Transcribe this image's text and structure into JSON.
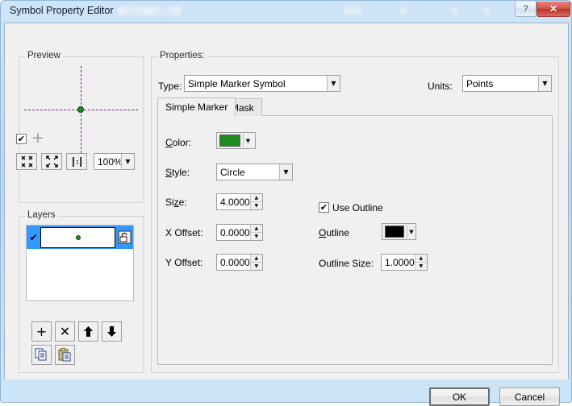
{
  "window": {
    "title": "Symbol Property Editor",
    "help_button": "?",
    "close_button": "✕"
  },
  "preview": {
    "legend": "Preview",
    "visible_checked": true,
    "check_glyph": "✔",
    "add_icon": "+",
    "zoom_in_name": "zoom-in",
    "zoom_out_name": "zoom-out",
    "zoom_ratio_name": "1:1",
    "zoom_value": "100%",
    "dropdown_arrow": "▼",
    "marker_color": "#1f8a1f",
    "crosshair_color": "#7b2f7b"
  },
  "layers": {
    "legend": "Layers",
    "rows": [
      {
        "checked": true,
        "check_glyph": "✔",
        "lock_icon": "unlock-icon",
        "selected": true
      }
    ],
    "buttons": {
      "add": "+",
      "delete": "✕",
      "move_up": "↑",
      "move_down": "↓",
      "copy": "copy-icon",
      "paste": "paste-icon"
    }
  },
  "properties": {
    "legend": "Properties:",
    "type_label": "Type:",
    "type_value": "Simple Marker Symbol",
    "units_label": "Units:",
    "units_value": "Points",
    "dropdown_arrow": "▼",
    "tabs": [
      {
        "label": "Simple Marker",
        "active": true
      },
      {
        "label": "Mask",
        "active": false
      }
    ]
  },
  "simple_marker": {
    "color_label": "Color:",
    "color_value": "#1f8a1f",
    "style_label": "Style:",
    "style_value": "Circle",
    "size_label": "Size:",
    "size_value": "4.0000",
    "x_offset_label": "X Offset:",
    "x_offset_value": "0.0000",
    "y_offset_label": "Y Offset:",
    "y_offset_value": "0.0000",
    "use_outline_label": "Use Outline",
    "use_outline_checked": true,
    "check_glyph": "✔",
    "outline_label": "Outline",
    "outline_color": "#000000",
    "outline_size_label": "Outline Size:",
    "outline_size_value": "1.0000",
    "spin_up": "▲",
    "spin_down": "▼",
    "dropdown_arrow": "▼"
  },
  "footer": {
    "ok_label": "OK",
    "cancel_label": "Cancel"
  }
}
